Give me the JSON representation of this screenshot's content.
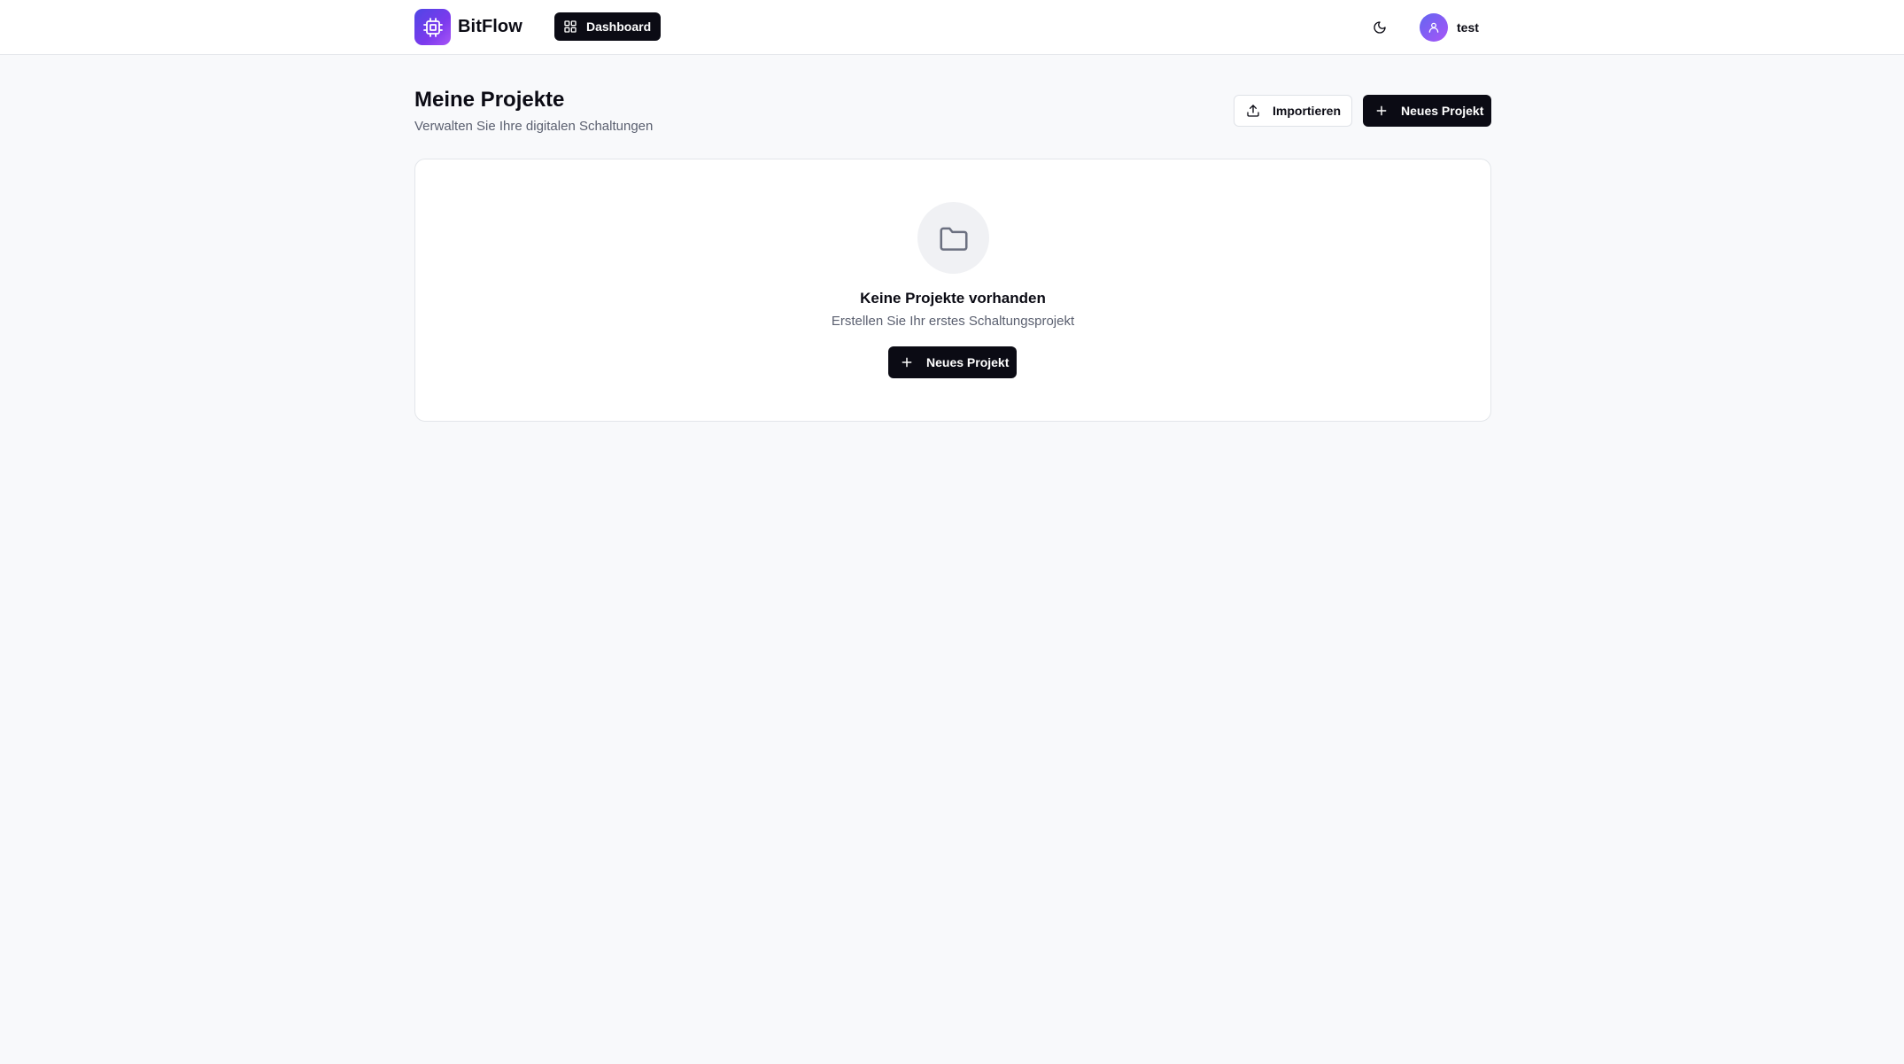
{
  "header": {
    "brand_name": "BitFlow",
    "nav_dashboard_label": "Dashboard",
    "user_name": "test",
    "icons": {
      "logo": "cpu-chip-icon",
      "dashboard": "grid-icon",
      "theme": "moon-icon",
      "avatar": "user-icon"
    }
  },
  "page": {
    "title": "Meine Projekte",
    "subtitle": "Verwalten Sie Ihre digitalen Schaltungen",
    "import_label": "Importieren",
    "new_project_label": "Neues Projekt",
    "icons": {
      "import": "upload-icon",
      "new": "plus-icon"
    }
  },
  "empty_state": {
    "title": "Keine Projekte vorhanden",
    "text": "Erstellen Sie Ihr erstes Schaltungsprojekt",
    "button_label": "Neues Projekt",
    "icon": "folder-icon"
  },
  "colors": {
    "primary": "#0b0b14",
    "brand_gradient_start": "#4f46e5",
    "brand_gradient_end": "#a855f7",
    "background": "#f8f9fb"
  }
}
